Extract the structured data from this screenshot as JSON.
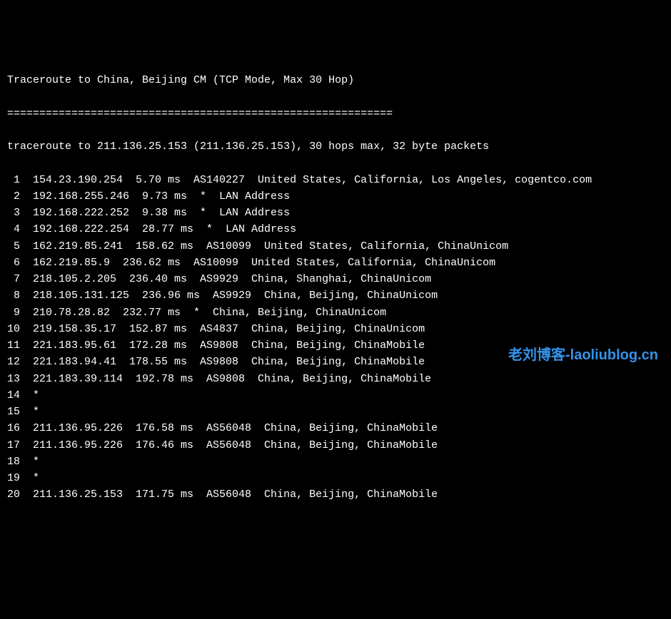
{
  "header": {
    "title": "Traceroute to China, Beijing CM (TCP Mode, Max 30 Hop)",
    "divider": "============================================================",
    "summary": "traceroute to 211.136.25.153 (211.136.25.153), 30 hops max, 32 byte packets"
  },
  "hops": [
    {
      "num": "1",
      "ip": "154.23.190.254",
      "rtt": "5.70 ms",
      "asn": "AS140227",
      "loc": "United States, California, Los Angeles, cogentco.com"
    },
    {
      "num": "2",
      "ip": "192.168.255.246",
      "rtt": "9.73 ms",
      "asn": "*",
      "loc": "LAN Address"
    },
    {
      "num": "3",
      "ip": "192.168.222.252",
      "rtt": "9.38 ms",
      "asn": "*",
      "loc": "LAN Address"
    },
    {
      "num": "4",
      "ip": "192.168.222.254",
      "rtt": "28.77 ms",
      "asn": "*",
      "loc": "LAN Address"
    },
    {
      "num": "5",
      "ip": "162.219.85.241",
      "rtt": "158.62 ms",
      "asn": "AS10099",
      "loc": "United States, California, ChinaUnicom"
    },
    {
      "num": "6",
      "ip": "162.219.85.9",
      "rtt": "236.62 ms",
      "asn": "AS10099",
      "loc": "United States, California, ChinaUnicom"
    },
    {
      "num": "7",
      "ip": "218.105.2.205",
      "rtt": "236.40 ms",
      "asn": "AS9929",
      "loc": "China, Shanghai, ChinaUnicom"
    },
    {
      "num": "8",
      "ip": "218.105.131.125",
      "rtt": "236.96 ms",
      "asn": "AS9929",
      "loc": "China, Beijing, ChinaUnicom"
    },
    {
      "num": "9",
      "ip": "210.78.28.82",
      "rtt": "232.77 ms",
      "asn": "*",
      "loc": "China, Beijing, ChinaUnicom"
    },
    {
      "num": "10",
      "ip": "219.158.35.17",
      "rtt": "152.87 ms",
      "asn": "AS4837",
      "loc": "China, Beijing, ChinaUnicom"
    },
    {
      "num": "11",
      "ip": "221.183.95.61",
      "rtt": "172.28 ms",
      "asn": "AS9808",
      "loc": "China, Beijing, ChinaMobile"
    },
    {
      "num": "12",
      "ip": "221.183.94.41",
      "rtt": "178.55 ms",
      "asn": "AS9808",
      "loc": "China, Beijing, ChinaMobile"
    },
    {
      "num": "13",
      "ip": "221.183.39.114",
      "rtt": "192.78 ms",
      "asn": "AS9808",
      "loc": "China, Beijing, ChinaMobile"
    },
    {
      "num": "14",
      "timeout": "*"
    },
    {
      "num": "15",
      "timeout": "*"
    },
    {
      "num": "16",
      "ip": "211.136.95.226",
      "rtt": "176.58 ms",
      "asn": "AS56048",
      "loc": "China, Beijing, ChinaMobile"
    },
    {
      "num": "17",
      "ip": "211.136.95.226",
      "rtt": "176.46 ms",
      "asn": "AS56048",
      "loc": "China, Beijing, ChinaMobile"
    },
    {
      "num": "18",
      "timeout": "*"
    },
    {
      "num": "19",
      "timeout": "*"
    },
    {
      "num": "20",
      "ip": "211.136.25.153",
      "rtt": "171.75 ms",
      "asn": "AS56048",
      "loc": "China, Beijing, ChinaMobile"
    }
  ],
  "watermark": "老刘博客-laoliublog.cn"
}
